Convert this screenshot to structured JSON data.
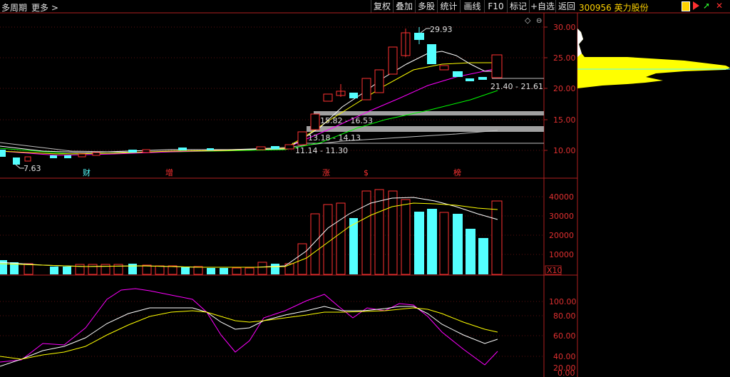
{
  "topbar": {
    "left": [
      "多周期",
      "更多 >"
    ],
    "buttons": [
      "复权",
      "叠加",
      "多股",
      "统计",
      "画线",
      "F10",
      "标记",
      "+自选",
      "返回"
    ],
    "stock": "300956 英力股份"
  },
  "price_axis": [
    "30.00",
    "25.00",
    "20.00",
    "15.00",
    "10.00"
  ],
  "vol_axis": [
    "40000",
    "30000",
    "20000",
    "10000",
    "X10"
  ],
  "kdj_axis": [
    "100.00",
    "80.00",
    "60.00",
    "40.00",
    "20.00",
    "0.00"
  ],
  "annotations": {
    "high": "29.93",
    "low": "7.63",
    "band1": "21.40 - 21.61",
    "band2": "15.82 - 16.53",
    "band3": "13.18 - 14.13",
    "band4": "11.14 - 11.30"
  },
  "markers": [
    "财",
    "增",
    "涨",
    "$",
    "榜"
  ],
  "colors": {
    "up": "#ff3232",
    "down": "#54ffff",
    "ma5": "#ffffff",
    "ma10": "#ffff00",
    "ma20": "#ff00ff",
    "ma60": "#00ff00",
    "chip": "#ffff00"
  }
}
